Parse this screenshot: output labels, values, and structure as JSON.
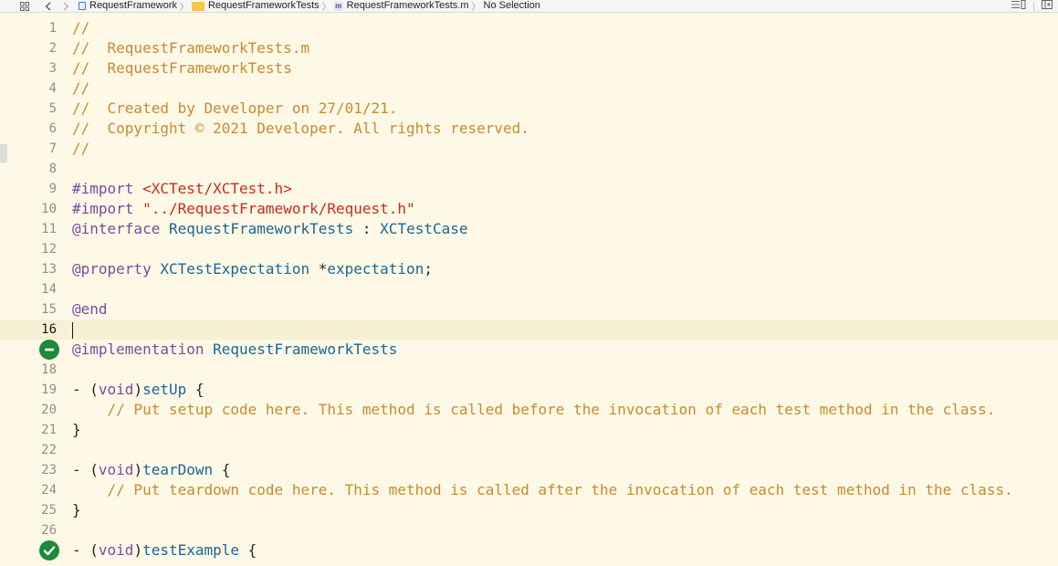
{
  "jumpbar": {
    "grid_icon": "grid-icon",
    "back_icon": "chevron-left-icon",
    "forward_icon": "chevron-right-icon",
    "crumbs": [
      {
        "icon": "project-file-icon",
        "label": "RequestFramework"
      },
      {
        "icon": "folder-icon",
        "label": "RequestFrameworkTests"
      },
      {
        "icon": "objc-file-icon",
        "label": "RequestFrameworkTests.m",
        "icon_letter": "m"
      },
      {
        "icon": "",
        "label": "No Selection"
      }
    ],
    "right_icons": [
      "editor-options-icon",
      "add-editor-icon"
    ]
  },
  "editor": {
    "current_line": 16,
    "colors": {
      "background": "#fdf9e6",
      "current_line": "#f7f0d5",
      "comment": "#c98a2c",
      "keyword": "#7b4aa0",
      "string": "#cc2a1a",
      "type": "#1c6596",
      "test_badge": "#1b8a3a"
    },
    "lines": [
      {
        "n": "1",
        "segments": [
          {
            "t": "//",
            "c": "comment"
          }
        ]
      },
      {
        "n": "2",
        "segments": [
          {
            "t": "//  RequestFrameworkTests.m",
            "c": "comment"
          }
        ]
      },
      {
        "n": "3",
        "segments": [
          {
            "t": "//  RequestFrameworkTests",
            "c": "comment"
          }
        ]
      },
      {
        "n": "4",
        "segments": [
          {
            "t": "//",
            "c": "comment"
          }
        ]
      },
      {
        "n": "5",
        "segments": [
          {
            "t": "//  Created by Developer on 27/01/21.",
            "c": "comment"
          }
        ]
      },
      {
        "n": "6",
        "segments": [
          {
            "t": "//  Copyright © 2021 Developer. All rights reserved.",
            "c": "comment"
          }
        ]
      },
      {
        "n": "7",
        "segments": [
          {
            "t": "//",
            "c": "comment"
          }
        ]
      },
      {
        "n": "8",
        "segments": []
      },
      {
        "n": "9",
        "segments": [
          {
            "t": "#import ",
            "c": "keyword"
          },
          {
            "t": "<XCTest/XCTest.h>",
            "c": "string"
          }
        ]
      },
      {
        "n": "10",
        "segments": [
          {
            "t": "#import ",
            "c": "keyword"
          },
          {
            "t": "\"../RequestFramework/Request.h\"",
            "c": "string"
          }
        ]
      },
      {
        "n": "11",
        "segments": [
          {
            "t": "@interface ",
            "c": "keyword"
          },
          {
            "t": "RequestFrameworkTests",
            "c": "type"
          },
          {
            "t": " : ",
            "c": "plain"
          },
          {
            "t": "XCTestCase",
            "c": "type"
          }
        ]
      },
      {
        "n": "12",
        "segments": []
      },
      {
        "n": "13",
        "segments": [
          {
            "t": "@property ",
            "c": "keyword"
          },
          {
            "t": "XCTestExpectation",
            "c": "type"
          },
          {
            "t": " *",
            "c": "plain"
          },
          {
            "t": "expectation",
            "c": "type"
          },
          {
            "t": ";",
            "c": "plain"
          }
        ]
      },
      {
        "n": "14",
        "segments": []
      },
      {
        "n": "15",
        "segments": [
          {
            "t": "@end",
            "c": "keyword"
          }
        ]
      },
      {
        "n": "16",
        "segments": [],
        "current": true
      },
      {
        "n": "",
        "badge": "test-diamond-icon",
        "segments": [
          {
            "t": "@implementation ",
            "c": "keyword"
          },
          {
            "t": "RequestFrameworkTests",
            "c": "type"
          }
        ]
      },
      {
        "n": "18",
        "segments": []
      },
      {
        "n": "19",
        "segments": [
          {
            "t": "- (",
            "c": "plain"
          },
          {
            "t": "void",
            "c": "keyword"
          },
          {
            "t": ")",
            "c": "plain"
          },
          {
            "t": "setUp",
            "c": "type"
          },
          {
            "t": " {",
            "c": "plain"
          }
        ]
      },
      {
        "n": "20",
        "segments": [
          {
            "t": "    // Put setup code here. This method is called before the invocation of each test method in the class.",
            "c": "comment"
          }
        ]
      },
      {
        "n": "21",
        "segments": [
          {
            "t": "}",
            "c": "plain"
          }
        ]
      },
      {
        "n": "22",
        "segments": []
      },
      {
        "n": "23",
        "segments": [
          {
            "t": "- (",
            "c": "plain"
          },
          {
            "t": "void",
            "c": "keyword"
          },
          {
            "t": ")",
            "c": "plain"
          },
          {
            "t": "tearDown",
            "c": "type"
          },
          {
            "t": " {",
            "c": "plain"
          }
        ]
      },
      {
        "n": "24",
        "segments": [
          {
            "t": "    // Put teardown code here. This method is called after the invocation of each test method in the class.",
            "c": "comment"
          }
        ]
      },
      {
        "n": "25",
        "segments": [
          {
            "t": "}",
            "c": "plain"
          }
        ]
      },
      {
        "n": "26",
        "segments": []
      },
      {
        "n": "",
        "badge": "test-passed-icon",
        "segments": [
          {
            "t": "- (",
            "c": "plain"
          },
          {
            "t": "void",
            "c": "keyword"
          },
          {
            "t": ")",
            "c": "plain"
          },
          {
            "t": "testExample",
            "c": "type"
          },
          {
            "t": " {",
            "c": "plain"
          }
        ]
      }
    ]
  }
}
